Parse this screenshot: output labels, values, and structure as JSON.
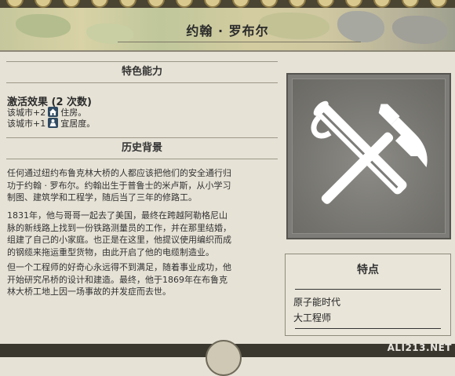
{
  "header": {
    "title": "约翰 · 罗布尔"
  },
  "sections": {
    "ability_header": "特色能力",
    "history_header": "历史背景"
  },
  "ability": {
    "title": "激活效果 (2 次数)",
    "line1_prefix": "该城市+2",
    "line1_suffix": "住房。",
    "line1_icon": "housing-icon",
    "line2_prefix": "该城市+1",
    "line2_suffix": "宜居度。",
    "line2_icon": "amenities-icon"
  },
  "history": {
    "para1": [
      "任何通过纽约布鲁克林大桥的人都应该把他们的安全通行归",
      "功于约翰 · 罗布尔。约翰出生于普鲁士的米卢斯，从小学习",
      "制图、建筑学和工程学，随后当了三年的修路工。"
    ],
    "para2": [
      "1831年，他与哥哥一起去了美国，最终在跨越阿勒格尼山",
      "脉的新线路上找到一份铁路测量员的工作，并在那里结婚，",
      "组建了自己的小家庭。也正是在这里，他提议使用编织而成",
      "的钢缆来拖运重型货物，由此开启了他的电缆制造业。"
    ],
    "para3": [
      "但一个工程师的好奇心永远得不到满足，随着事业成功，他",
      "开始研究吊桥的设计和建造。最终，他于1869年在布鲁克",
      "林大桥工地上因一场事故的并发症而去世。"
    ]
  },
  "portrait": {
    "icon": "engineer-tools-icon"
  },
  "traits": {
    "title": "特点",
    "items": [
      "原子能时代",
      "大工程师"
    ]
  },
  "watermark": "ALI213.NET",
  "colors": {
    "background": "#e6e2d6",
    "portrait_bg": "#7d7c78",
    "icon_white": "#ffffff",
    "inline_icon_bg": "#2f4a62"
  }
}
